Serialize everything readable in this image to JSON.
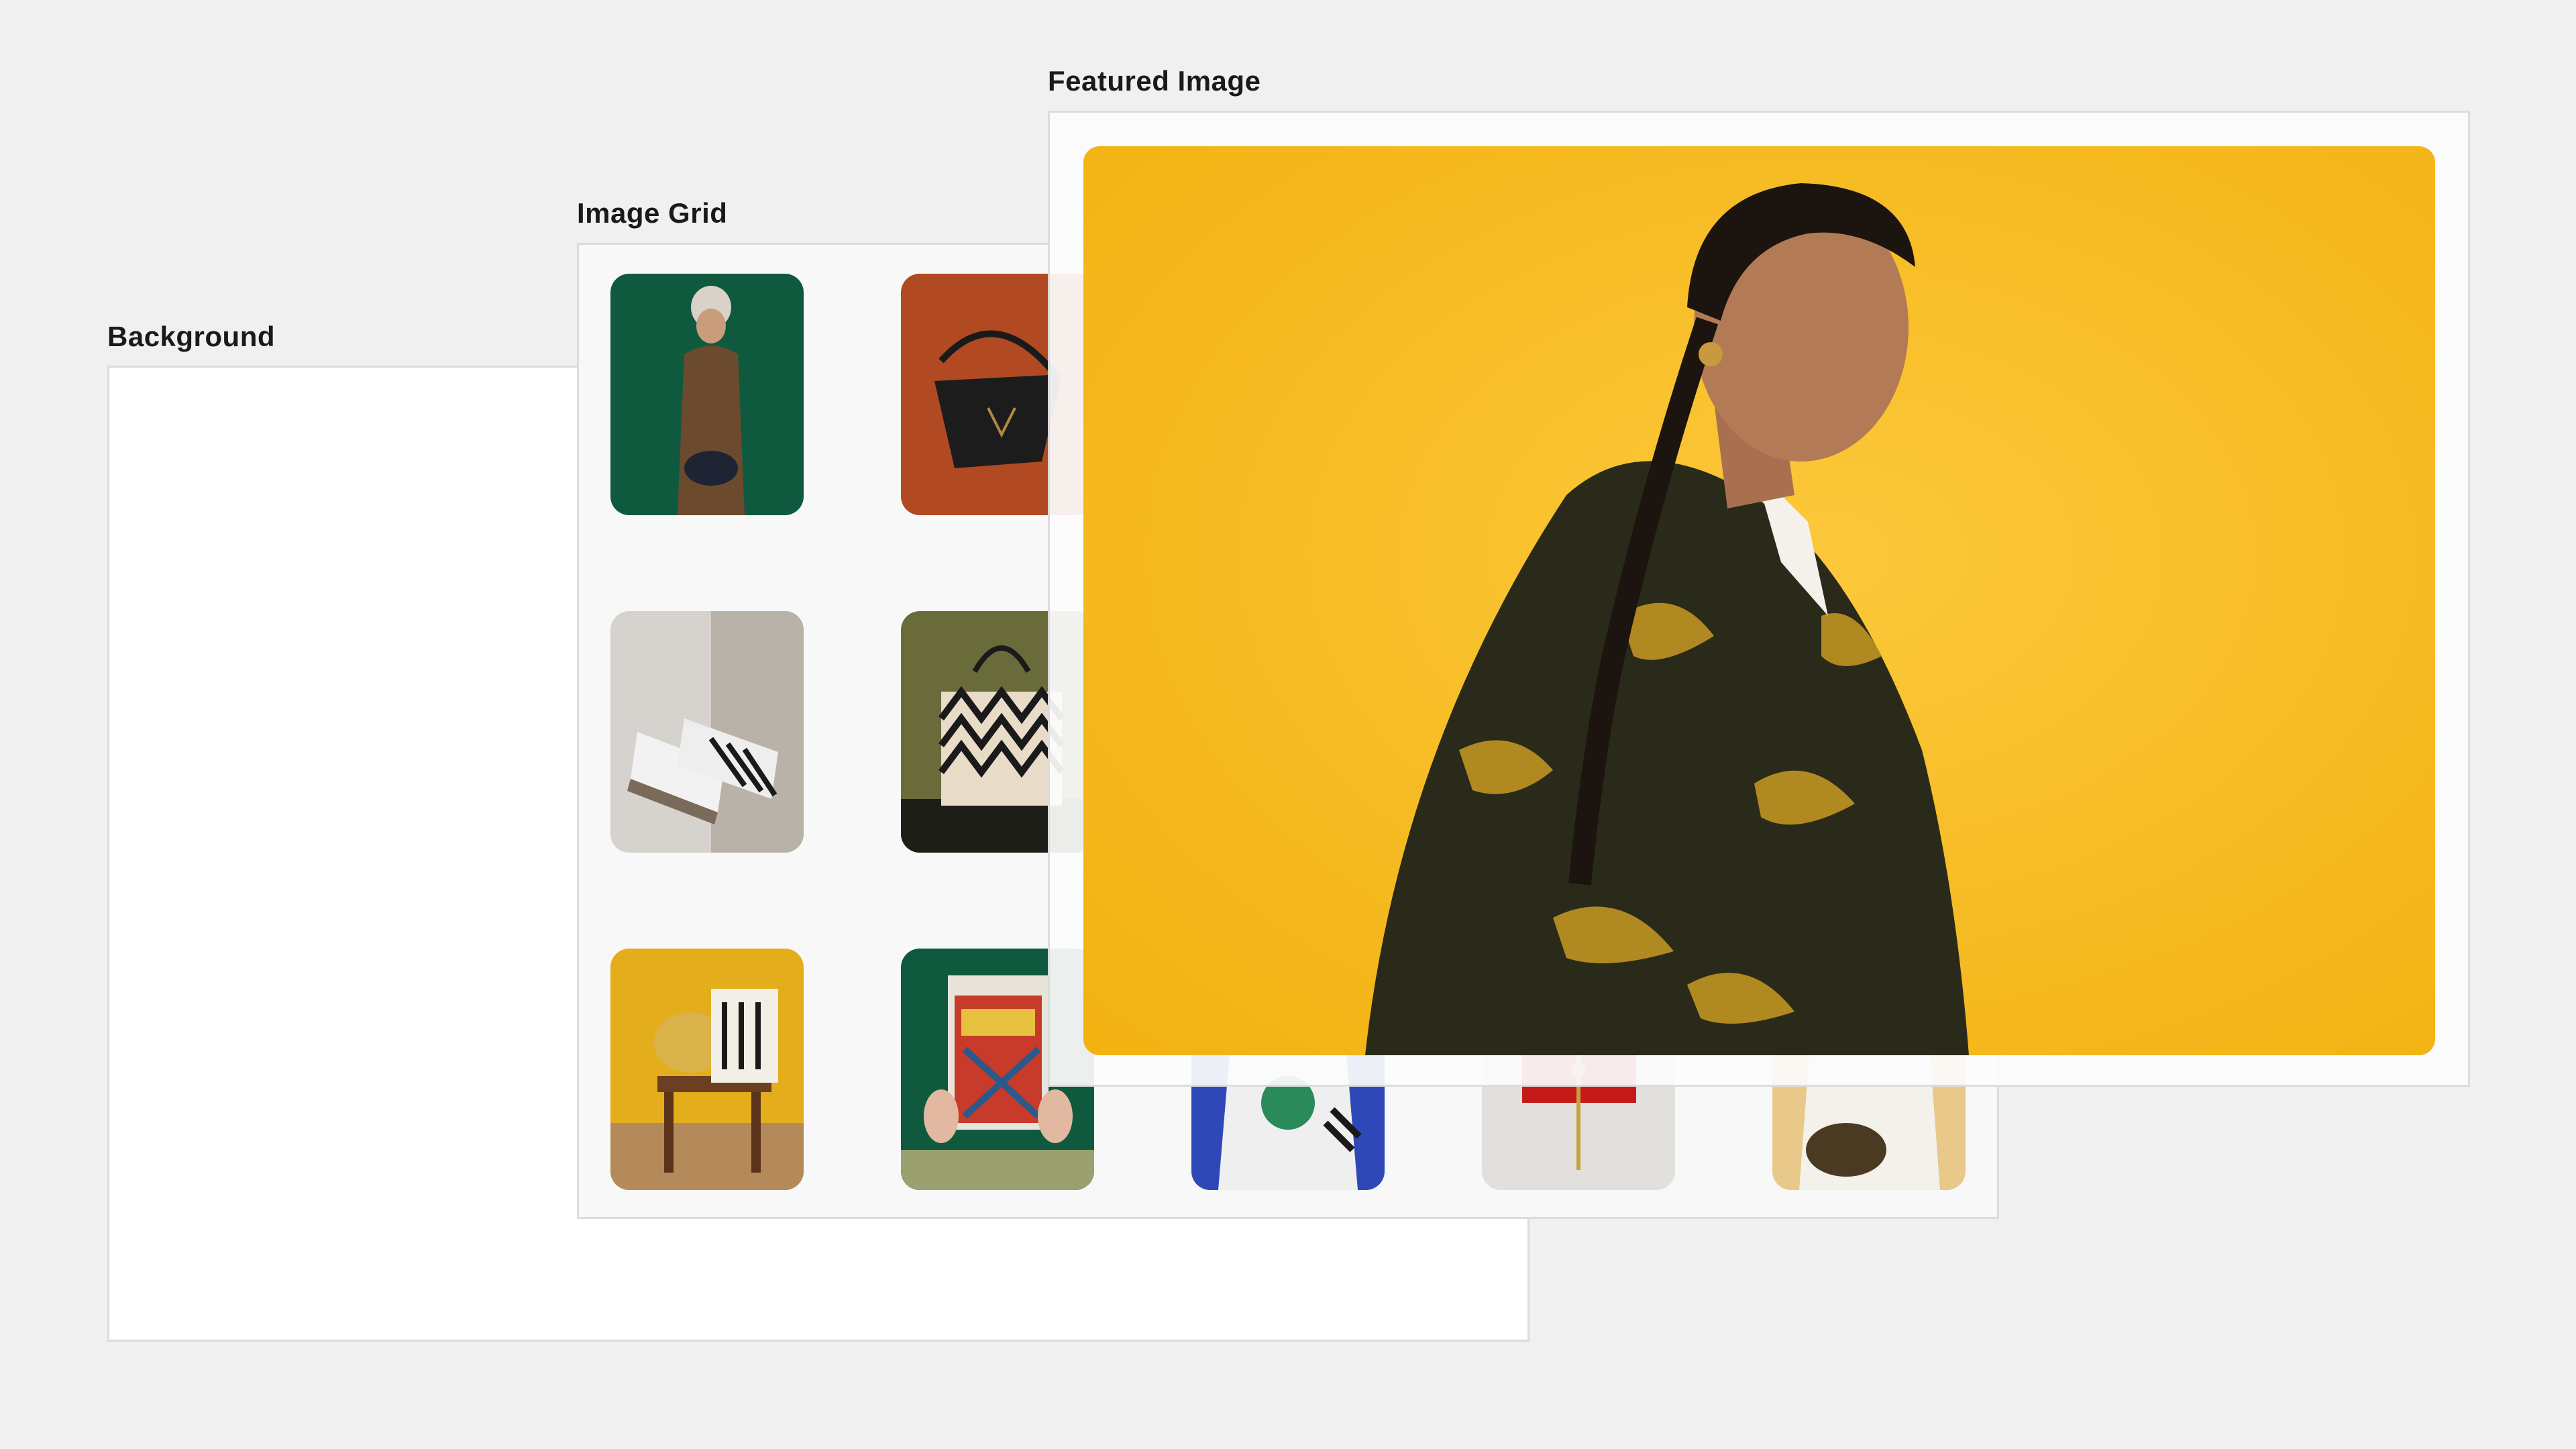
{
  "layers": {
    "background_label": "Background",
    "grid_label": "Image Grid",
    "featured_label": "Featured Image"
  },
  "grid": {
    "tiles": [
      {
        "name": "woman-green-backdrop-photo",
        "bg": "#0f5a3e"
      },
      {
        "name": "black-handbag-photo",
        "bg": "#b14a22"
      },
      {
        "name": "sneakers-photo",
        "bg": "#c9c6c0"
      },
      {
        "name": "tote-bag-photo",
        "bg": "#6a6b3a"
      },
      {
        "name": "cap-chair-photo",
        "bg": "#e4ad1c"
      },
      {
        "name": "comic-book-photo",
        "bg": "#0f5a3e"
      },
      {
        "name": "varsity-jacket-photo",
        "bg": "#2f48b8"
      },
      {
        "name": "red-clutch-photo",
        "bg": "#e2e0dc"
      },
      {
        "name": "white-shirt-bag-photo",
        "bg": "#e8c98a"
      }
    ]
  },
  "featured": {
    "image_name": "woman-yellow-backdrop-photo",
    "bg": "#f7bd1c",
    "coat": "#2a2a1a",
    "pattern": "#b08a20"
  },
  "colors": {
    "page_bg": "#f0f0f0",
    "panel_border": "#dcdcdc",
    "label_text": "#1a1a1a"
  }
}
